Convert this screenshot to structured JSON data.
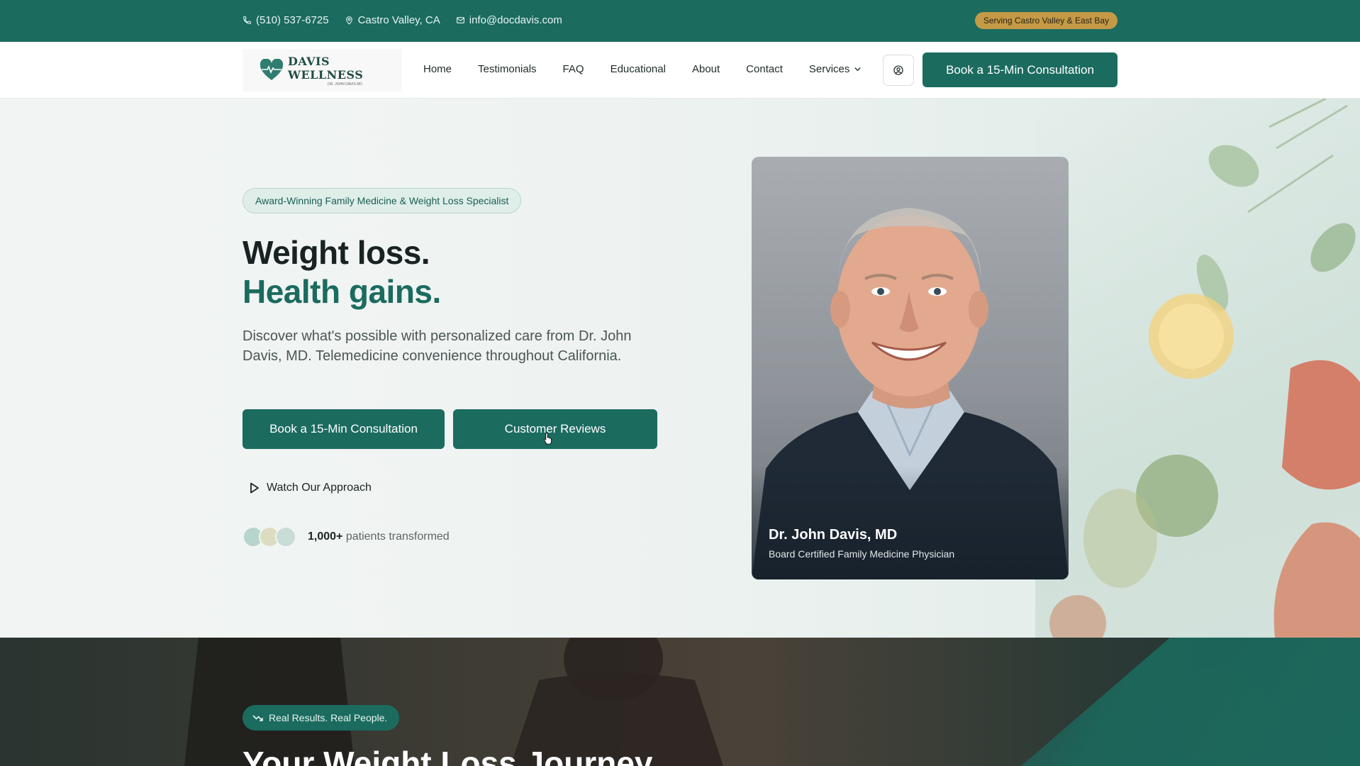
{
  "topbar": {
    "phone": "(510) 537-6725",
    "location": "Castro Valley, CA",
    "email": "info@docdavis.com",
    "badge": "Serving Castro Valley & East Bay",
    "badge_color": "#c49a46"
  },
  "nav": {
    "logo_name": "DAVIS WELLNESS",
    "logo_sub": "DR. JOHN DAVIS MD",
    "links": [
      "Home",
      "Testimonials",
      "FAQ",
      "Educational",
      "About",
      "Contact"
    ],
    "services_label": "Services",
    "account_icon": "user-circle-icon",
    "cta": "Book a 15-Min Consultation"
  },
  "hero": {
    "pill": "Award-Winning Family Medicine & Weight Loss Specialist",
    "headline_1": "Weight loss.",
    "headline_2": "Health gains.",
    "description": "Discover what's possible with personalized care from Dr. John Davis, MD. Telemedicine convenience throughout California.",
    "primary_button": "Book a 15-Min Consultation",
    "secondary_button": "Customer Reviews",
    "watch_label": "Watch Our Approach",
    "patients_count": "1,000+",
    "patients_text": "patients transformed",
    "doctor_name": "Dr. John Davis, MD",
    "doctor_title": "Board Certified Family Medicine Physician"
  },
  "results": {
    "pill": "Real Results. Real People.",
    "title": "Your Weight Loss Journey"
  },
  "colors": {
    "brand": "#1b6b5f",
    "accent": "#c49a46"
  }
}
